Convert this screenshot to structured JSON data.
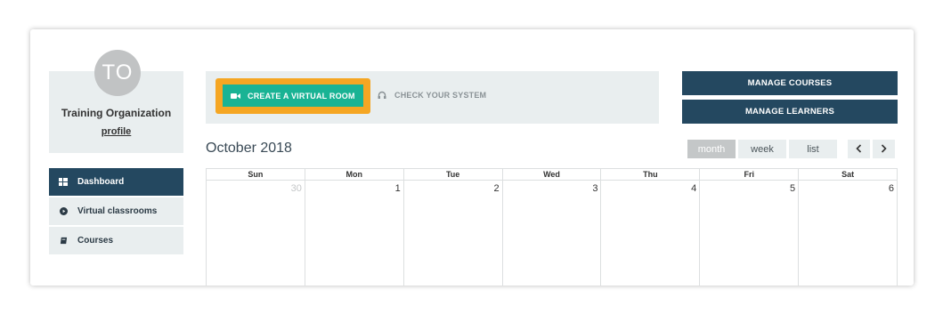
{
  "profile": {
    "initials": "TO",
    "name": "Training Organization",
    "profile_link": "profile"
  },
  "sidebar": {
    "items": [
      {
        "label": "Dashboard",
        "icon": "dashboard-icon",
        "active": true
      },
      {
        "label": "Virtual classrooms",
        "icon": "play-circle-icon",
        "active": false
      },
      {
        "label": "Courses",
        "icon": "book-icon",
        "active": false
      }
    ]
  },
  "actions": {
    "create_room_label": "CREATE A VIRTUAL ROOM",
    "check_system_label": "CHECK YOUR SYSTEM",
    "manage_courses_label": "MANAGE COURSES",
    "manage_learners_label": "MANAGE LEARNERS"
  },
  "calendar": {
    "title": "October 2018",
    "views": {
      "month": "month",
      "week": "week",
      "list": "list"
    },
    "selected_view": "month",
    "prev_icon": "chevron-left-icon",
    "next_icon": "chevron-right-icon",
    "weekdays": [
      "Sun",
      "Mon",
      "Tue",
      "Wed",
      "Thu",
      "Fri",
      "Sat"
    ],
    "week1": [
      "30",
      "1",
      "2",
      "3",
      "4",
      "5",
      "6"
    ]
  },
  "colors": {
    "navy": "#244860",
    "teal": "#19b394",
    "orange_highlight": "#f5a623",
    "panel_bg": "#e9eeef"
  }
}
